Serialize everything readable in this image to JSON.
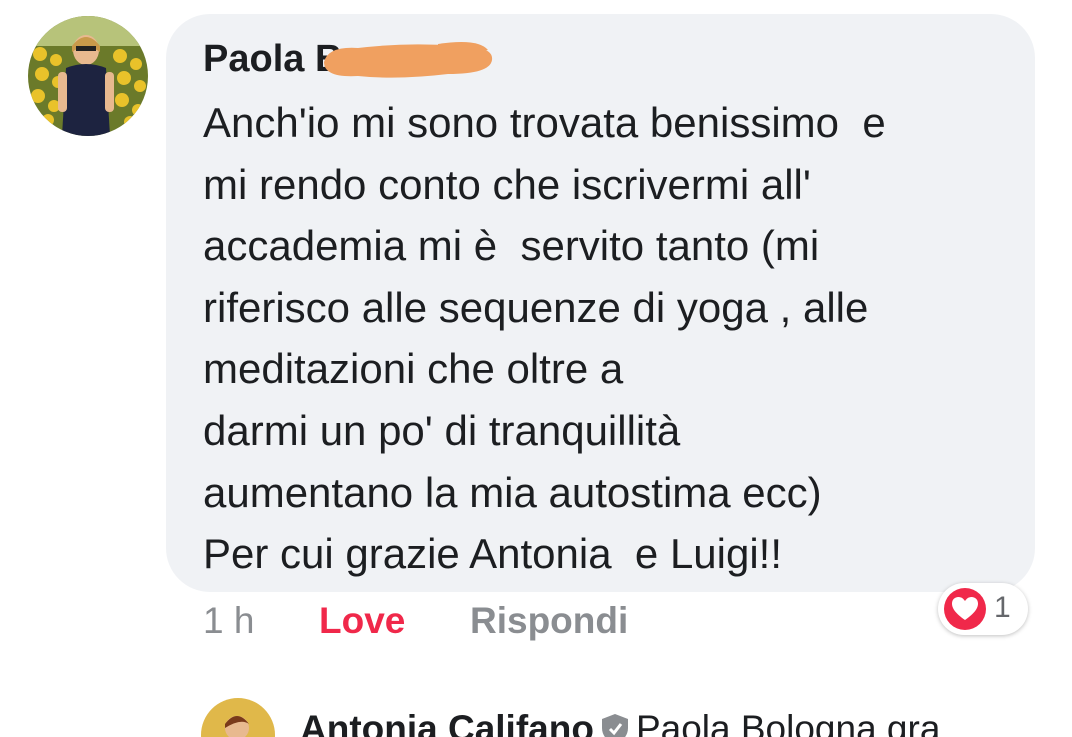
{
  "comment": {
    "author": "Paola B",
    "author_redacted": true,
    "lines": [
      "Anch'io mi sono trovata benissimo  e",
      "mi rendo conto che iscrivermi all'",
      "accademia mi è  servito tanto (mi",
      "riferisco alle sequenze di yoga , alle",
      "meditazioni che oltre a",
      "darmi un po' di tranquillità",
      "aumentano la mia autostima ecc)",
      "Per cui grazie Antonia  e Luigi!!"
    ],
    "time": "1 h",
    "love_label": "Love",
    "reply_label": "Rispondi",
    "reaction": {
      "icon": "heart-icon",
      "count": "1",
      "color": "#f0284a"
    }
  },
  "reply": {
    "author": "Antonia Califano",
    "badge_icon": "shield-icon",
    "text": "Paola Bologna gra"
  },
  "colors": {
    "bubble": "#f0f2f5",
    "text": "#1c1e21",
    "muted": "#8a8d91",
    "love": "#f0284a",
    "redaction": "#f0a060"
  }
}
